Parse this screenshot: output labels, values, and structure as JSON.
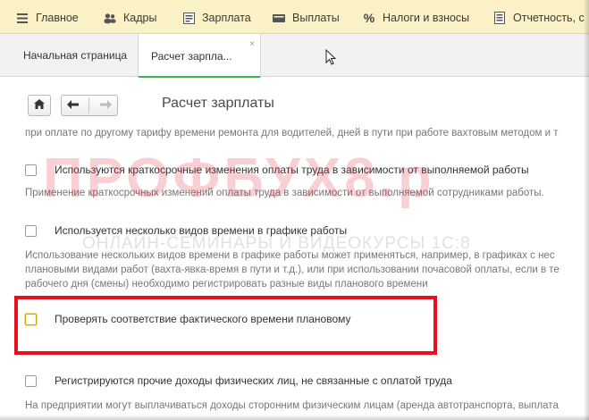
{
  "menubar": {
    "items": [
      {
        "label": "Главное",
        "icon": "hamburger-icon"
      },
      {
        "label": "Кадры",
        "icon": "people-icon"
      },
      {
        "label": "Зарплата",
        "icon": "document-icon"
      },
      {
        "label": "Выплаты",
        "icon": "wallet-icon"
      },
      {
        "label": "Налоги и взносы",
        "icon": "percent-icon"
      },
      {
        "label": "Отчетность, с",
        "icon": "report-icon"
      }
    ]
  },
  "tabs": [
    {
      "label": "Начальная страница",
      "active": false
    },
    {
      "label": "Расчет зарпла...",
      "active": true,
      "close": "×"
    }
  ],
  "form": {
    "title": "Расчет зарплаты",
    "nav": {
      "home": "home-icon",
      "back": "arrow-left-icon",
      "forward": "arrow-right-icon"
    }
  },
  "content": {
    "top_cutoff_text": "при оплате по другому тарифу времени ремонта для водителей, дней в пути при работе вахтовым методом и т",
    "options": [
      {
        "label": "Используются краткосрочные изменения оплаты труда в зависимости от выполняемой работы",
        "checked": false,
        "description": [
          "Применение краткосрочных изменений оплаты труда в зависимости от выполняемой сотрудниками работы."
        ]
      },
      {
        "label": "Используется несколько видов времени в графике работы",
        "checked": false,
        "description": [
          "Использование нескольких видов времени в графике работы может применяться, например, в графиках с нес",
          "плановыми видами работ (вахта-явка-время в пути и т.д.), или при использовании почасовой оплаты, если в те",
          "рабочего дня (смены) необходимо регистрировать разные виды планового времени"
        ]
      },
      {
        "label": "Проверять соответствие фактического времени плановому",
        "checked": false,
        "description": []
      },
      {
        "label": "Регистрируются прочие доходы физических лиц, не связанные с оплатой труда",
        "checked": false,
        "description": [
          "На предприятии могут выплачиваться доходы сторонним физическим лицам (аренда автотранспорта, выплата"
        ]
      }
    ]
  },
  "watermark": {
    "main": "ПРОФБУХ8.р",
    "sub": "ОНЛАЙН-СЕМИНАРЫ И ВИДЕОКУРСЫ 1С:8"
  },
  "colors": {
    "menubar_bg": "#fbf1c7",
    "tab_active_underline": "#3fb34f",
    "highlight_red": "#e8101c"
  }
}
